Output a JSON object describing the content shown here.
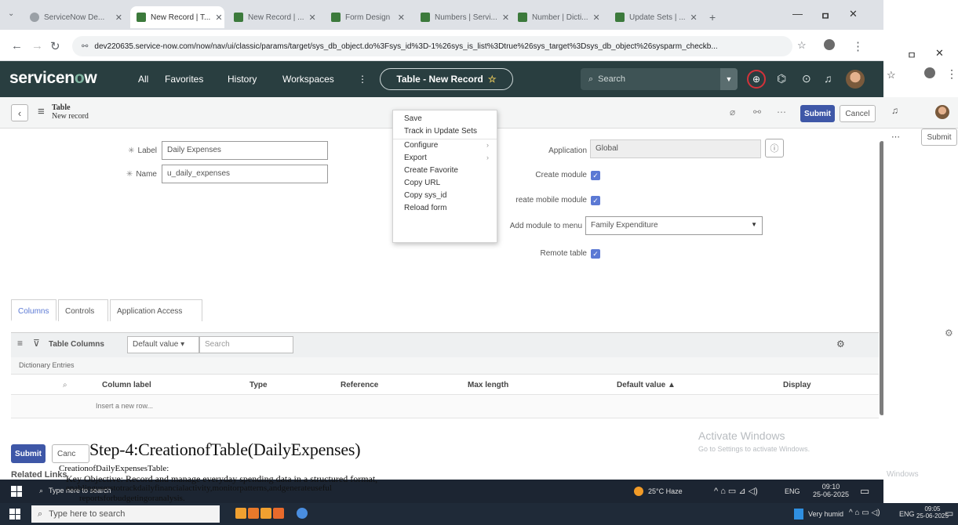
{
  "browser": {
    "tabs": [
      {
        "title": "ServiceNow De..."
      },
      {
        "title": "New Record | T..."
      },
      {
        "title": "New Record | ..."
      },
      {
        "title": "Form Design"
      },
      {
        "title": "Numbers | Servi..."
      },
      {
        "title": "Number | Dicti..."
      },
      {
        "title": "Update Sets | ..."
      }
    ],
    "url_prefix": "dev220635.service-now.com/now/nav/ui/classic/params/target/",
    "url": "sys_db_object.do%3Fsys_id%3D-1%26sys_is_list%3Dtrue%26sys_target%3Dsys_db_object%26sysparm_checkb..."
  },
  "header": {
    "logo_main": "servicen",
    "logo_o": "o",
    "logo_tail": "w",
    "menu": [
      "All",
      "Favorites",
      "History",
      "Workspaces"
    ],
    "more": "⋮",
    "context": "Table - New Record",
    "search_placeholder": "Search"
  },
  "form_toolbar": {
    "title": "Table",
    "subtitle": "New record",
    "submit": "Submit",
    "cancel": "Cancel"
  },
  "form": {
    "label_label": "Label",
    "label_value": "Daily Expenses",
    "name_label": "Name",
    "name_value": "u_daily_expenses",
    "application_label": "Application",
    "application_value": "Global",
    "create_module_label": "Create module",
    "create_mobile_module_label": "reate mobile module",
    "add_module_label": "Add module to menu",
    "add_module_value": "Family Expenditure",
    "remote_table_label": "Remote table"
  },
  "context_menu": [
    {
      "label": "Save",
      "sub": ""
    },
    {
      "label": "Track in Update Sets",
      "sub": ""
    },
    {
      "label": "Configure",
      "sub": "›"
    },
    {
      "label": "Export",
      "sub": "›"
    },
    {
      "label": "Create Favorite",
      "sub": ""
    },
    {
      "label": "Copy URL",
      "sub": ""
    },
    {
      "label": "Copy sys_id",
      "sub": ""
    },
    {
      "label": "Reload form",
      "sub": ""
    }
  ],
  "related": {
    "tabs": [
      "Columns",
      "Controls",
      "Application Access"
    ],
    "list_title": "Table Columns",
    "filter_value": "Default value",
    "search_placeholder": "Search",
    "dictionary": "Dictionary Entries",
    "columns": [
      "Column label",
      "Type",
      "Reference",
      "Max length",
      "Default value ▲",
      "Display"
    ],
    "insert_row": "Insert a new row..."
  },
  "bottom": {
    "submit": "Submit",
    "cancel": "Canc",
    "related_links": "Related Links"
  },
  "watermark": {
    "line1": "Activate Windows",
    "line2": "Go to Settings to activate Windows."
  },
  "doc_overlay": {
    "step": "Step-4:CreationofTable(DailyExpenses)",
    "creation": "CreationofDailyExpensesTable:",
    "key": "Key Objective: Record and manage everyday spending data in a structured format,",
    "enable": "enablinguserstotrackdailyfinancialactivity,monitorpatterns,andgenerateuseful",
    "reports": "reportsforbudgetingoranalysis."
  },
  "taskbar_inner": {
    "search": "Type here to search",
    "weather": "25°C Haze",
    "lang": "ENG",
    "time": "09:10",
    "date": "25-06-2025"
  },
  "taskbar_outer": {
    "search": "Type here to search",
    "weather": "Very humid",
    "lang": "ENG",
    "time": "09:05",
    "date": "25-06-2025"
  },
  "right_strip": {
    "submit": "Submit",
    "windows": "Windows"
  },
  "colors": {
    "sn_header": "#293e40",
    "submit": "#3e57a7",
    "checkbox": "#5b79d4",
    "notify_ring": "#d4323a"
  }
}
